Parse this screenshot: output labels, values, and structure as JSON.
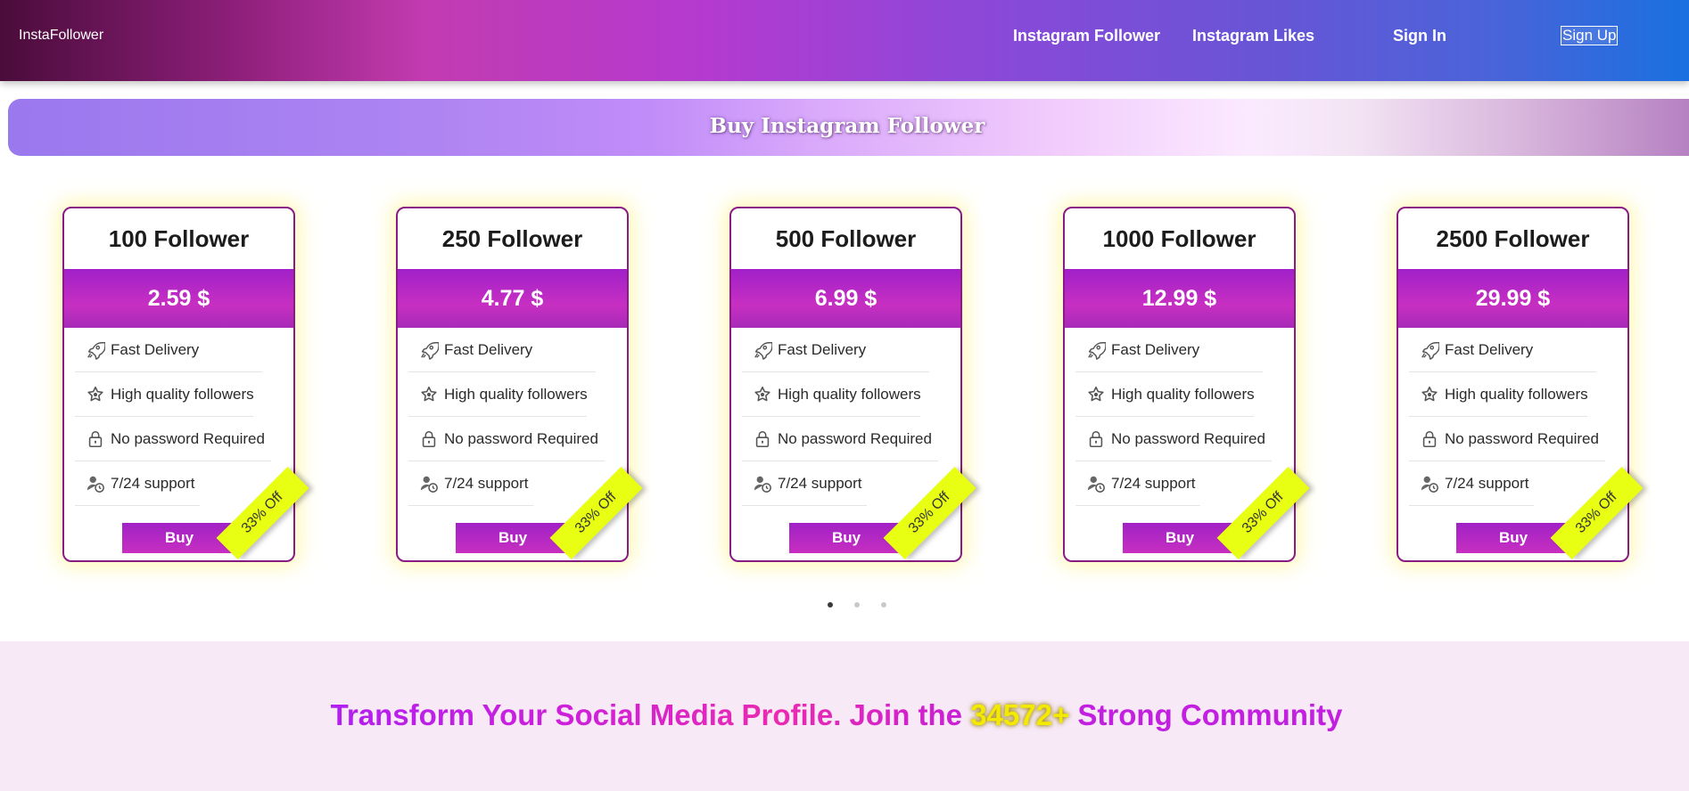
{
  "header": {
    "brand": "InstaFollower",
    "nav": {
      "instagram_follower": "Instagram Follower",
      "instagram_likes": "Instagram Likes",
      "sign_in": "Sign In",
      "sign_up": "Sign Up"
    }
  },
  "banner": {
    "title": "Buy Instagram Follower"
  },
  "plans": [
    {
      "title": "100 Follower",
      "price": "2.59 $"
    },
    {
      "title": "250 Follower",
      "price": "4.77 $"
    },
    {
      "title": "500 Follower",
      "price": "6.99 $"
    },
    {
      "title": "1000 Follower",
      "price": "12.99 $"
    },
    {
      "title": "2500 Follower",
      "price": "29.99 $"
    }
  ],
  "features": {
    "fast_delivery": "Fast Delivery",
    "high_quality": "High quality followers",
    "no_password": "No password Required",
    "support": "7/24 support"
  },
  "card": {
    "buy_label": "Buy",
    "ribbon": "33% Off"
  },
  "icons": [
    "rocket-icon",
    "star-badge-icon",
    "lock-icon",
    "user-clock-icon"
  ],
  "carousel": {
    "pages": 3,
    "active_page": 1
  },
  "community": {
    "text_before": "Transform Your Social Media Profile. Join the ",
    "count": "34572+",
    "text_after": " Strong Community"
  },
  "colors": {
    "brand_purple": "#a020c8",
    "ribbon_yellow": "#e8ff14",
    "card_border": "#8a1a86",
    "bottom_bg": "#f7e9f6"
  }
}
